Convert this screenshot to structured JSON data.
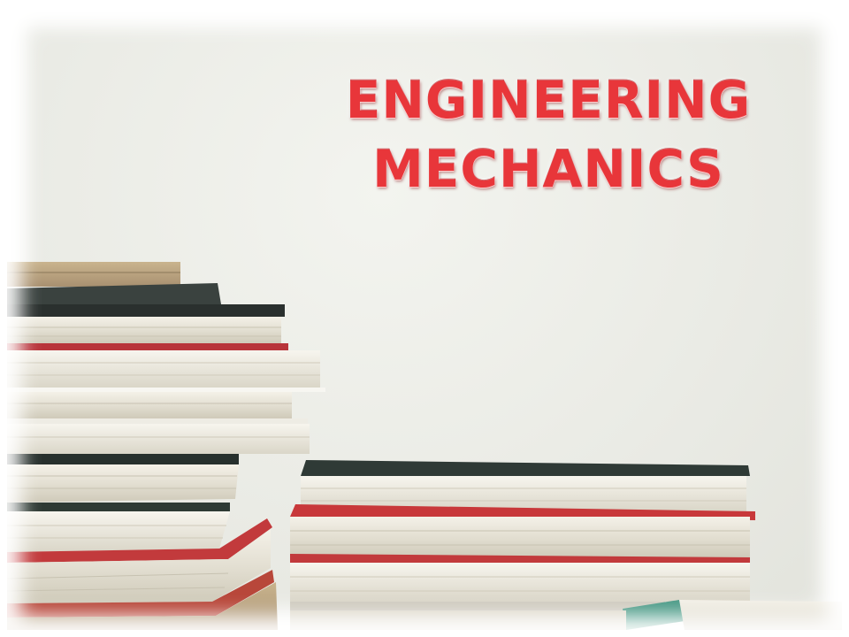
{
  "slide": {
    "title_lines": [
      "ENGINEERING",
      "MECHANICS"
    ],
    "title_color": "#e8363a",
    "background_color": "#eaebe5"
  },
  "photo": {
    "subject": "stacks-of-books",
    "cover_colors": [
      "#2f3a36",
      "#c8383a",
      "#d9c9a6",
      "#4a9a86"
    ]
  }
}
